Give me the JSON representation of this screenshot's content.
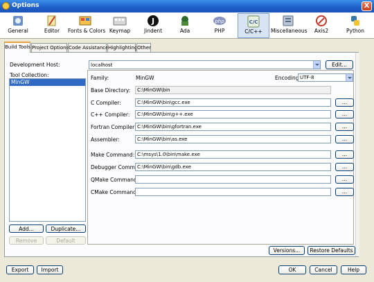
{
  "window": {
    "title": "Options",
    "close_glyph": "X"
  },
  "toolbar": [
    {
      "label": "General",
      "icon": "general-icon"
    },
    {
      "label": "Editor",
      "icon": "editor-icon"
    },
    {
      "label": "Fonts & Colors",
      "icon": "fonts-colors-icon"
    },
    {
      "label": "Keymap",
      "icon": "keymap-icon"
    },
    {
      "label": "Jindent",
      "icon": "jindent-icon",
      "glyph": "J"
    },
    {
      "label": "Ada",
      "icon": "ada-icon"
    },
    {
      "label": "PHP",
      "icon": "php-icon",
      "glyph": "php"
    },
    {
      "label": "C/C++",
      "icon": "c-cpp-icon",
      "glyph": "C/C",
      "selected": true
    },
    {
      "label": "Miscellaneous",
      "icon": "miscellaneous-icon"
    },
    {
      "label": "Axis2",
      "icon": "axis2-icon"
    },
    {
      "label": "Python",
      "icon": "python-icon"
    }
  ],
  "tabs": [
    "Build Tools",
    "Project Options",
    "Code Assistance",
    "Highlighting",
    "Other"
  ],
  "left": {
    "dev_host_label": "Development Host:",
    "tool_collection_label": "Tool Collection:",
    "tool_collections": [
      "MinGW"
    ],
    "add": "Add...",
    "duplicate": "Duplicate...",
    "remove": "Remove",
    "default": "Default"
  },
  "host": {
    "value": "localhost",
    "edit": "Edit..."
  },
  "details": {
    "family_label": "Family:",
    "family_value": "MinGW",
    "encoding_label": "Encoding:",
    "encoding_value": "UTF-8",
    "base_dir_label": "Base Directory:",
    "base_dir_value": "C:\\MinGW\\bin",
    "browse": "...",
    "fields": [
      {
        "label": "C Compiler:",
        "value": "C:\\MinGW\\bin\\gcc.exe"
      },
      {
        "label": "C++ Compiler:",
        "value": "C:\\MinGW\\bin\\g++.exe"
      },
      {
        "label": "Fortran Compiler:",
        "value": "C:\\MinGW\\bin\\gfortran.exe"
      },
      {
        "label": "Assembler:",
        "value": "C:\\MinGW\\bin\\as.exe"
      },
      {
        "label": "Make Command:",
        "value": "C:\\msys\\1.0\\bin\\make.exe"
      },
      {
        "label": "Debugger Command:",
        "value": "C:\\MinGW\\bin\\gdb.exe"
      },
      {
        "label": "QMake Command:",
        "value": ""
      },
      {
        "label": "CMake Command:",
        "value": ""
      }
    ]
  },
  "panel_buttons": {
    "versions": "Versions...",
    "restore": "Restore Defaults"
  },
  "footer": {
    "export": "Export",
    "import": "Import",
    "ok": "OK",
    "cancel": "Cancel",
    "help": "Help"
  },
  "colors": {
    "title_bar": "#1f5fc8",
    "selection": "#316ac5",
    "tab_accent": "#e6a23c"
  }
}
